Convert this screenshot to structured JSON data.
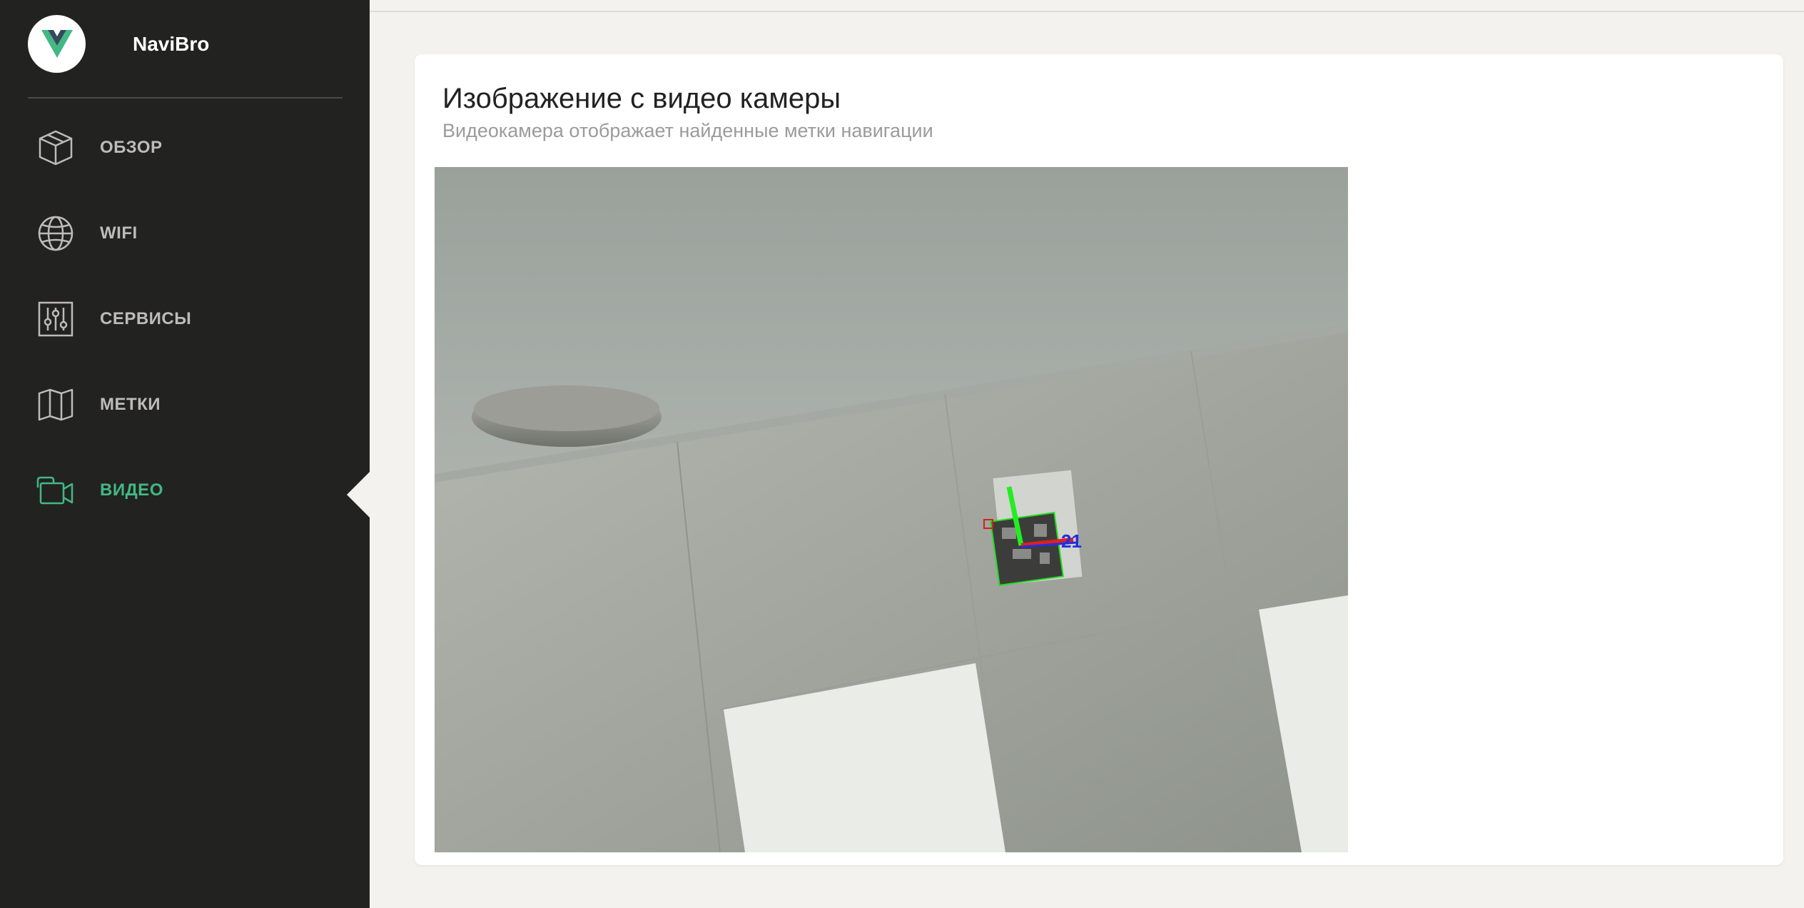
{
  "app": {
    "brand": "NaviBro"
  },
  "sidebar": {
    "items": [
      {
        "label": "ОБЗОР",
        "icon": "box-icon",
        "active": false
      },
      {
        "label": "WIFI",
        "icon": "globe-icon",
        "active": false
      },
      {
        "label": "СЕРВИСЫ",
        "icon": "sliders-icon",
        "active": false
      },
      {
        "label": "МЕТКИ",
        "icon": "map-icon",
        "active": false
      },
      {
        "label": "ВИДЕО",
        "icon": "video-camera-icon",
        "active": true
      }
    ]
  },
  "main": {
    "card": {
      "title": "Изображение с видео камеры",
      "subtitle": "Видеокамера отображает найденные метки навигации"
    },
    "video": {
      "marker_id": "21"
    }
  },
  "colors": {
    "sidebar_bg": "#222221",
    "accent": "#42b883",
    "nav_text": "#bdbcba",
    "page_bg": "#f3f2ee"
  }
}
